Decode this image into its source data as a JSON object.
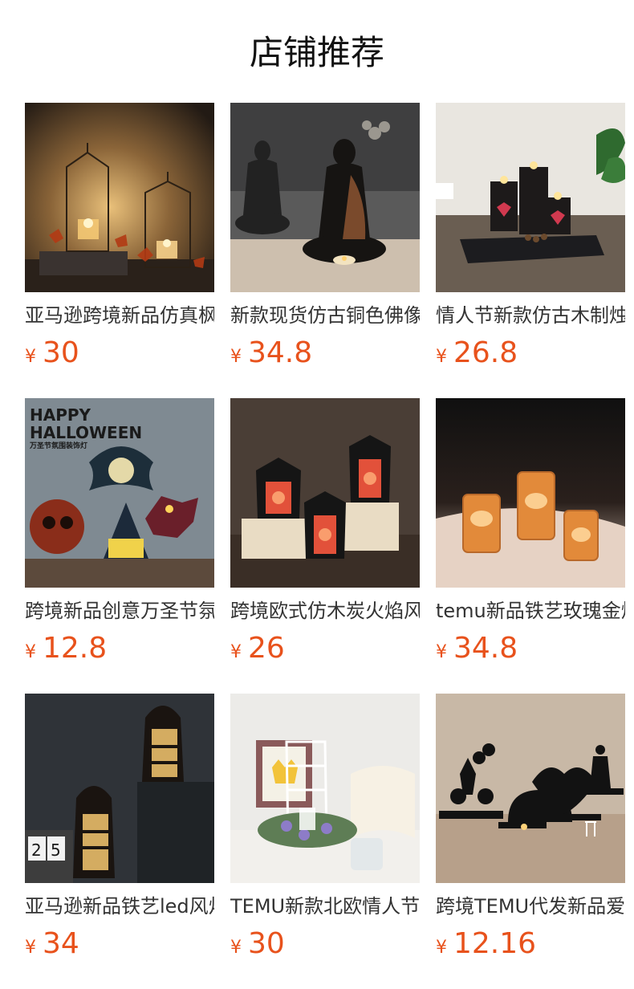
{
  "section": {
    "title": "店铺推荐"
  },
  "products": [
    {
      "name": "亚马逊跨境新品仿真枫叶铁艺风灯",
      "currency": "¥",
      "price": "30",
      "image": "metal-lantern-leaves"
    },
    {
      "name": "新款现货仿古铜色佛像烛台摆件",
      "currency": "¥",
      "price": "34.8",
      "image": "buddha-statues"
    },
    {
      "name": "情人节新款仿古木制烛台托盘套装",
      "currency": "¥",
      "price": "26.8",
      "image": "wood-candle-tray"
    },
    {
      "name": "跨境新品创意万圣节氛围装饰灯",
      "currency": "¥",
      "price": "12.8",
      "image": "halloween-lights"
    },
    {
      "name": "跨境欧式仿木炭火焰风灯摆件",
      "currency": "¥",
      "price": "26",
      "image": "flame-lanterns"
    },
    {
      "name": "temu新品铁艺玫瑰金烛台杯",
      "currency": "¥",
      "price": "34.8",
      "image": "rose-gold-candle-cups"
    },
    {
      "name": "亚马逊新品铁艺led风灯摩洛哥",
      "currency": "¥",
      "price": "34",
      "image": "moroccan-lanterns"
    },
    {
      "name": "TEMU新款北欧情人节花环烛台",
      "currency": "¥",
      "price": "30",
      "image": "wreath-candle-holder"
    },
    {
      "name": "跨境TEMU代发新品爱心情侣烛台",
      "currency": "¥",
      "price": "12.16",
      "image": "couple-silhouettes"
    }
  ],
  "colors": {
    "price": "#e8521c",
    "text": "#333333"
  }
}
